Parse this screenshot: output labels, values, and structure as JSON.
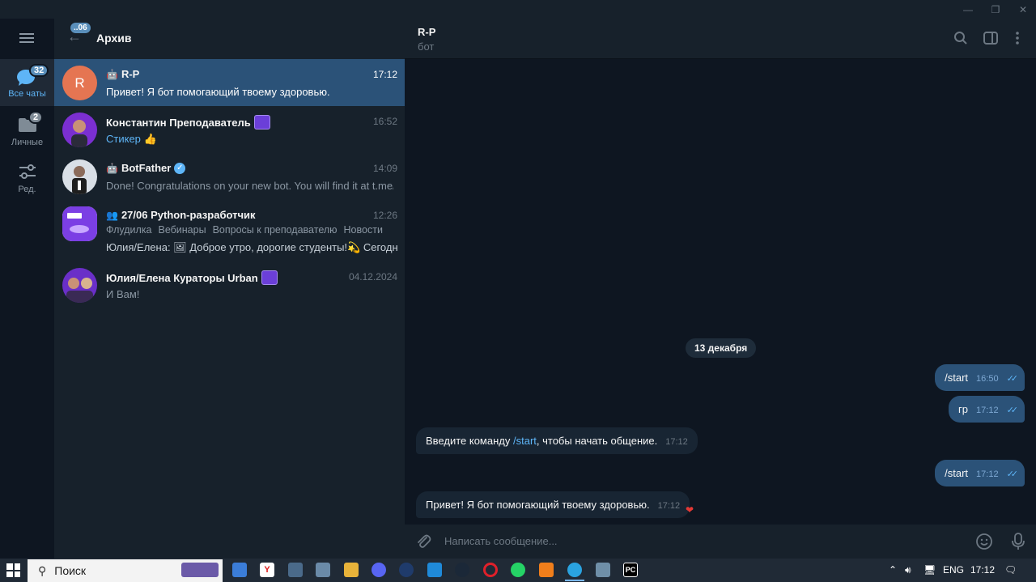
{
  "window": {
    "minimize_glyph": "—",
    "maximize_glyph": "❐",
    "close_glyph": "✕"
  },
  "rail": {
    "menu_icon": "hamburger-icon",
    "items": [
      {
        "label": "Все чаты",
        "badge": "32",
        "icon": "chat-bubbles-icon"
      },
      {
        "label": "Личные",
        "badge": "2",
        "icon": "folder-icon"
      },
      {
        "label": "Ред.",
        "icon": "sliders-icon"
      }
    ]
  },
  "archive": {
    "title": "Архив",
    "back_badge": "..06"
  },
  "chats": [
    {
      "name": "R-P",
      "time": "17:12",
      "preview": "Привет! Я бот помогающий твоему здоровью.",
      "avatar_letter": "R",
      "avatar_color": "#e57552",
      "is_bot": true,
      "selected": true
    },
    {
      "name": "Константин Преподаватель",
      "time": "16:52",
      "preview_accent": "Стикер",
      "preview_emoji": "👍"
    },
    {
      "name": "BotFather",
      "time": "14:09",
      "preview": "Done! Congratulations on your new bot. You will find it at t.me/...",
      "is_bot": true,
      "verified": true
    },
    {
      "name": "27/06 Python-разработчик",
      "time": "12:26",
      "tags": [
        "Флудилка",
        "Вебинары",
        "Вопросы к преподавателю",
        "Новости"
      ],
      "preview": "Юлия/Елена: 🖼 Доброе утро, дорогие студенты!💫 Сегодня..."
    },
    {
      "name": "Юлия/Елена Кураторы Urban",
      "time": "04.12.2024",
      "preview": "И Вам!"
    }
  ],
  "header": {
    "title": "R-P",
    "subtitle": "бот"
  },
  "messages": {
    "date": "13 декабря",
    "list": [
      {
        "dir": "out",
        "text": "/start",
        "time": "16:50"
      },
      {
        "dir": "out",
        "text": "гр",
        "time": "17:12"
      },
      {
        "dir": "in",
        "text_before": "Введите команду ",
        "command": "/start",
        "text_after": ", чтобы начать общение.",
        "time": "17:12"
      },
      {
        "dir": "out",
        "text": "/start",
        "time": "17:12"
      },
      {
        "dir": "in",
        "text": "Привет! Я бот помогающий твоему здоровью.",
        "time": "17:12",
        "reaction": "❤"
      }
    ]
  },
  "composer": {
    "placeholder": "Написать сообщение..."
  },
  "taskbar": {
    "search_label": "Поиск",
    "language": "ENG",
    "clock": "17:12"
  },
  "colors": {
    "accent": "#5eb5f7",
    "selected_row": "#2b5278",
    "outgoing_bubble": "#2b5278",
    "incoming_bubble": "#182533"
  }
}
